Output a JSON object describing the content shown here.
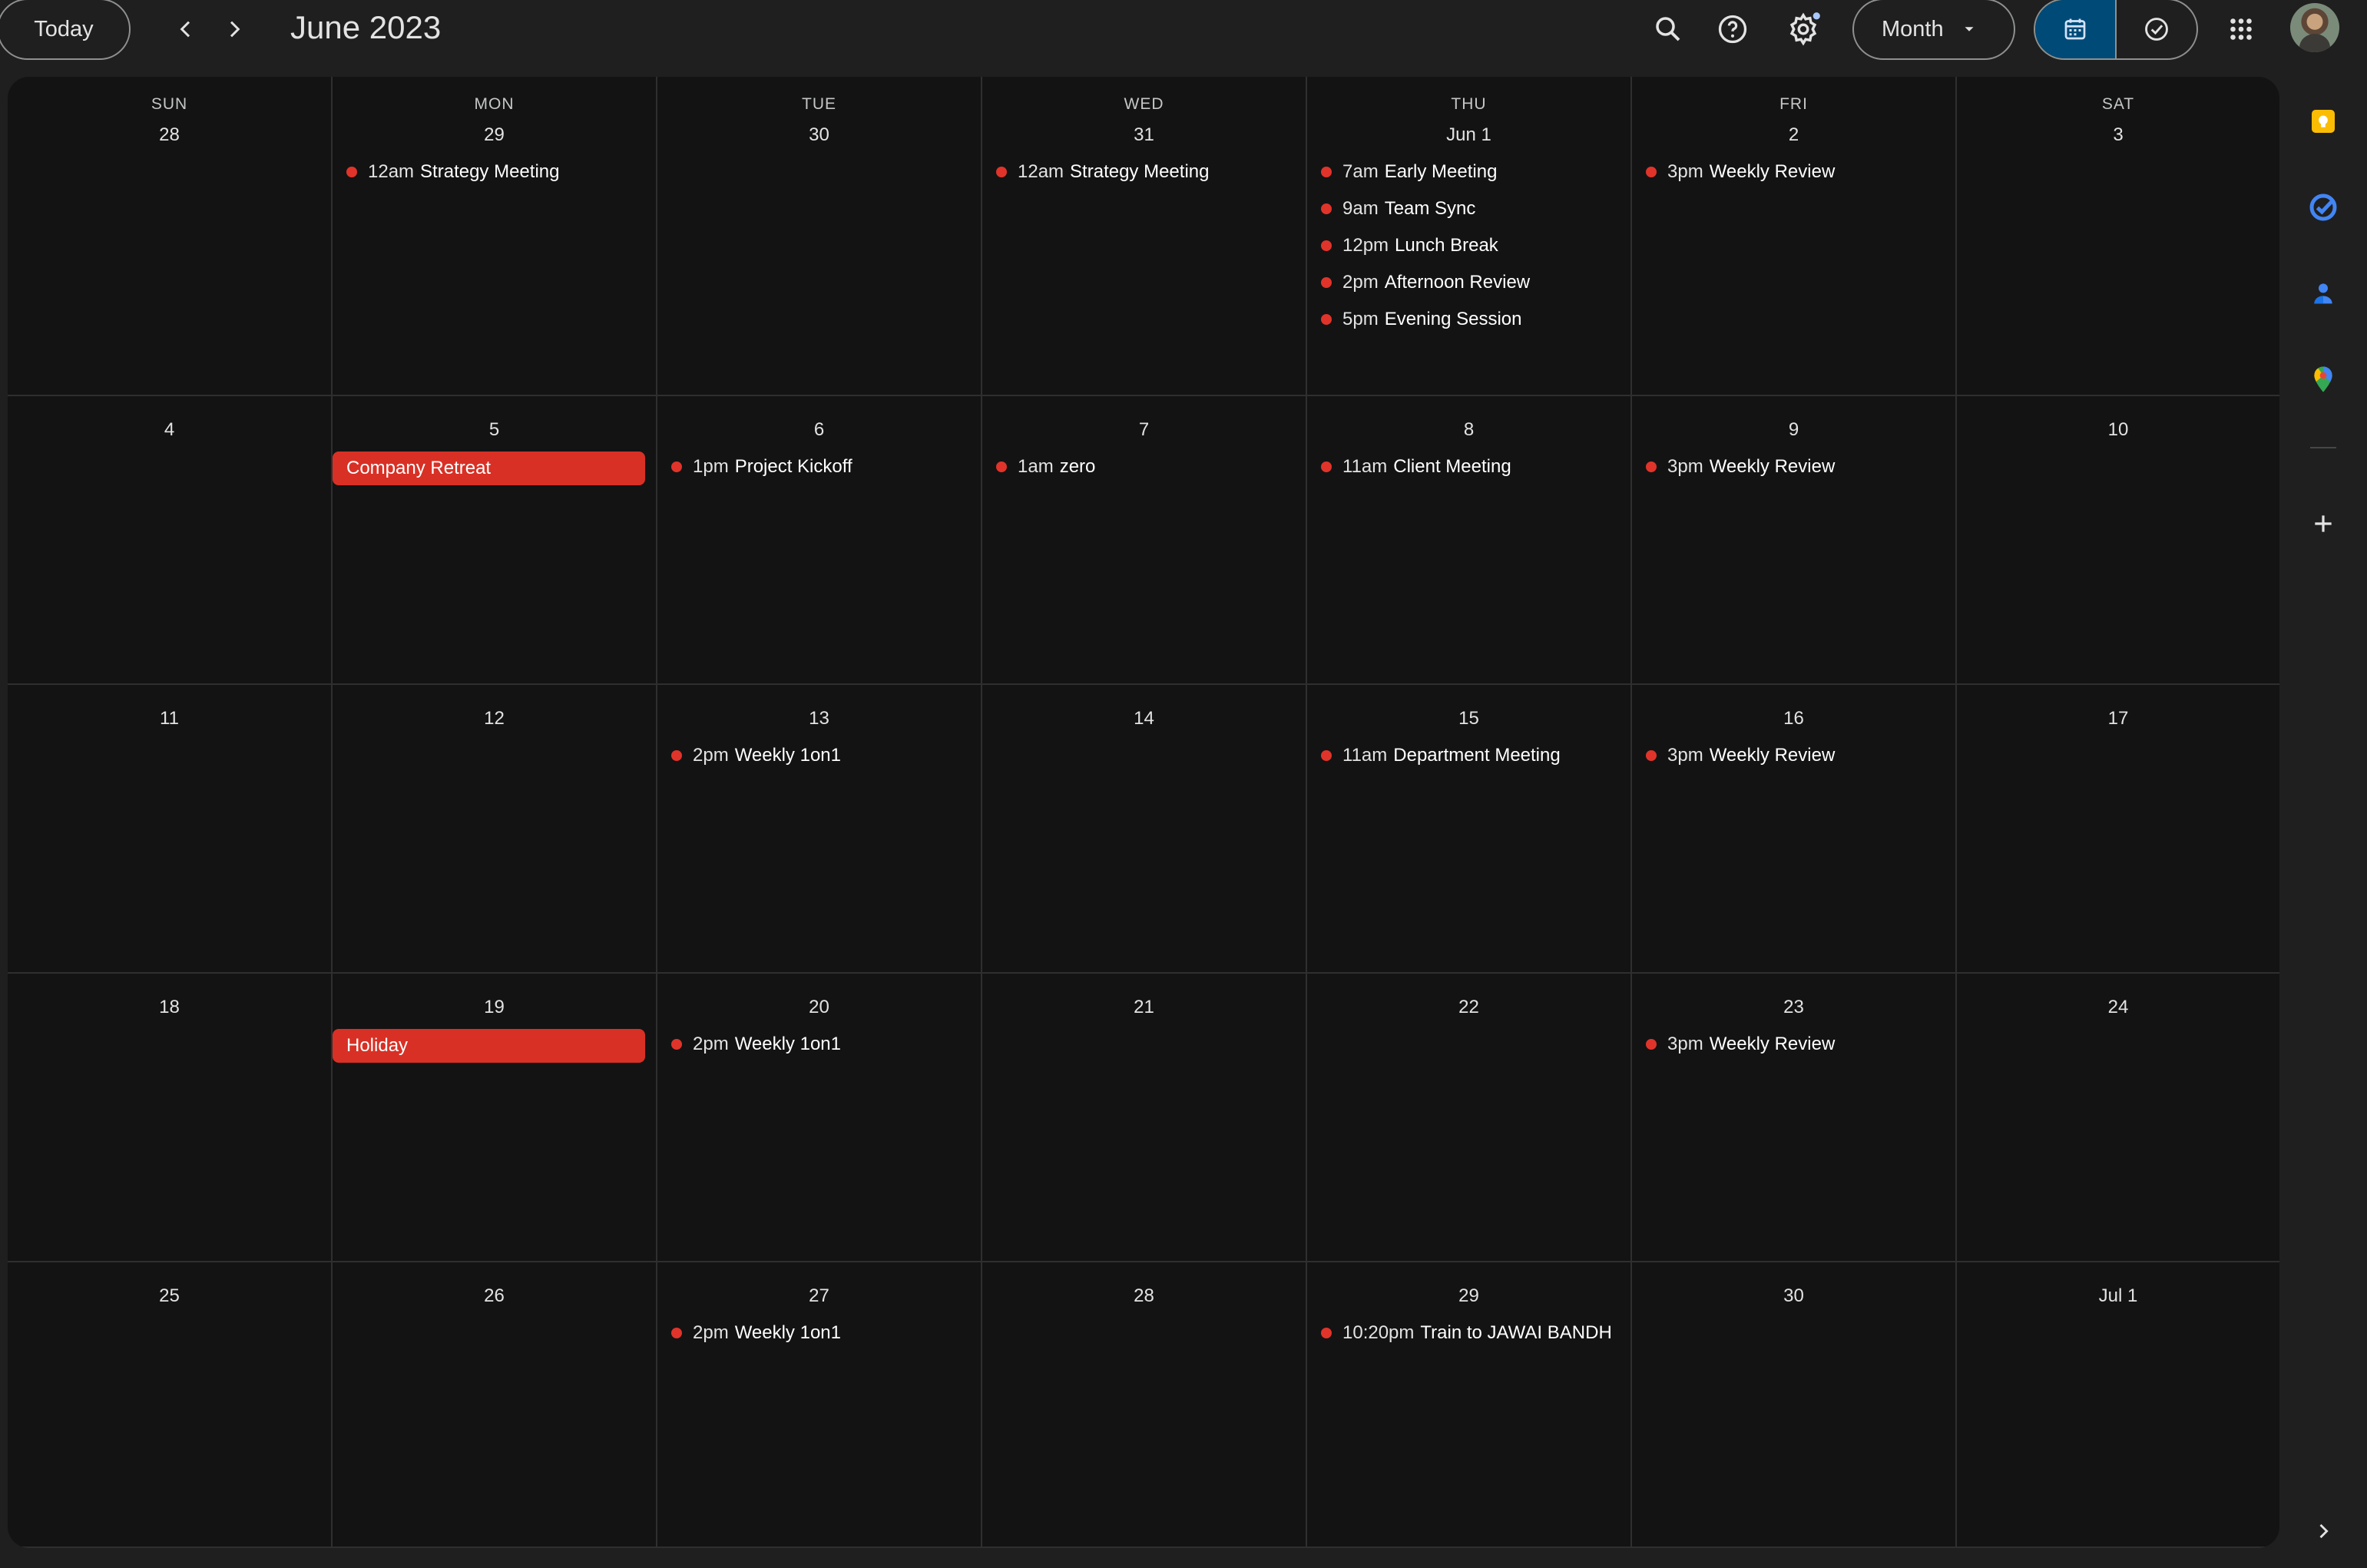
{
  "toolbar": {
    "today_label": "Today",
    "title": "June 2023",
    "view_label": "Month",
    "icons": {
      "prev": "chevron-left-icon",
      "next": "chevron-right-icon",
      "search": "search-icon",
      "help": "help-icon",
      "settings": "gear-icon",
      "view_dropdown": "caret-down-icon",
      "calendar_view": "calendar-icon",
      "tasks_view": "check-circle-icon",
      "apps": "apps-grid-icon",
      "account": "avatar"
    }
  },
  "colors": {
    "event_dot": "#e0342b",
    "allday_event": "#d93025",
    "active_segment": "#004a77",
    "grid_background": "#131313",
    "page_background": "#1f1f1f"
  },
  "calendar": {
    "weekdays": [
      "SUN",
      "MON",
      "TUE",
      "WED",
      "THU",
      "FRI",
      "SAT"
    ],
    "weeks": [
      [
        {
          "day": "28",
          "events": []
        },
        {
          "day": "29",
          "events": [
            {
              "time": "12am",
              "title": "Strategy Meeting"
            }
          ]
        },
        {
          "day": "30",
          "events": []
        },
        {
          "day": "31",
          "events": [
            {
              "time": "12am",
              "title": "Strategy Meeting"
            }
          ]
        },
        {
          "day": "Jun 1",
          "events": [
            {
              "time": "7am",
              "title": "Early Meeting"
            },
            {
              "time": "9am",
              "title": "Team Sync"
            },
            {
              "time": "12pm",
              "title": "Lunch Break"
            },
            {
              "time": "2pm",
              "title": "Afternoon Review"
            },
            {
              "time": "5pm",
              "title": "Evening Session"
            }
          ]
        },
        {
          "day": "2",
          "events": [
            {
              "time": "3pm",
              "title": "Weekly Review"
            }
          ]
        },
        {
          "day": "3",
          "events": []
        }
      ],
      [
        {
          "day": "4",
          "events": []
        },
        {
          "day": "5",
          "allday": "Company Retreat",
          "events": []
        },
        {
          "day": "6",
          "events": [
            {
              "time": "1pm",
              "title": "Project Kickoff"
            }
          ]
        },
        {
          "day": "7",
          "events": [
            {
              "time": "1am",
              "title": "zero"
            }
          ]
        },
        {
          "day": "8",
          "events": [
            {
              "time": "11am",
              "title": "Client Meeting"
            }
          ]
        },
        {
          "day": "9",
          "events": [
            {
              "time": "3pm",
              "title": "Weekly Review"
            }
          ]
        },
        {
          "day": "10",
          "events": []
        }
      ],
      [
        {
          "day": "11",
          "events": []
        },
        {
          "day": "12",
          "events": []
        },
        {
          "day": "13",
          "events": [
            {
              "time": "2pm",
              "title": "Weekly 1on1"
            }
          ]
        },
        {
          "day": "14",
          "events": []
        },
        {
          "day": "15",
          "events": [
            {
              "time": "11am",
              "title": "Department Meeting"
            }
          ]
        },
        {
          "day": "16",
          "events": [
            {
              "time": "3pm",
              "title": "Weekly Review"
            }
          ]
        },
        {
          "day": "17",
          "events": []
        }
      ],
      [
        {
          "day": "18",
          "events": []
        },
        {
          "day": "19",
          "allday": "Holiday",
          "events": []
        },
        {
          "day": "20",
          "events": [
            {
              "time": "2pm",
              "title": "Weekly 1on1"
            }
          ]
        },
        {
          "day": "21",
          "events": []
        },
        {
          "day": "22",
          "events": []
        },
        {
          "day": "23",
          "events": [
            {
              "time": "3pm",
              "title": "Weekly Review"
            }
          ]
        },
        {
          "day": "24",
          "events": []
        }
      ],
      [
        {
          "day": "25",
          "events": []
        },
        {
          "day": "26",
          "events": []
        },
        {
          "day": "27",
          "events": [
            {
              "time": "2pm",
              "title": "Weekly 1on1"
            }
          ]
        },
        {
          "day": "28",
          "events": []
        },
        {
          "day": "29",
          "events": [
            {
              "time": "10:20pm",
              "title": "Train to JAWAI BANDH"
            }
          ]
        },
        {
          "day": "30",
          "events": []
        },
        {
          "day": "Jul 1",
          "events": []
        }
      ]
    ]
  },
  "side_panel": {
    "icons": [
      "keep-icon",
      "tasks-icon",
      "contacts-icon",
      "maps-icon",
      "plus-icon",
      "chevron-right-icon"
    ]
  }
}
